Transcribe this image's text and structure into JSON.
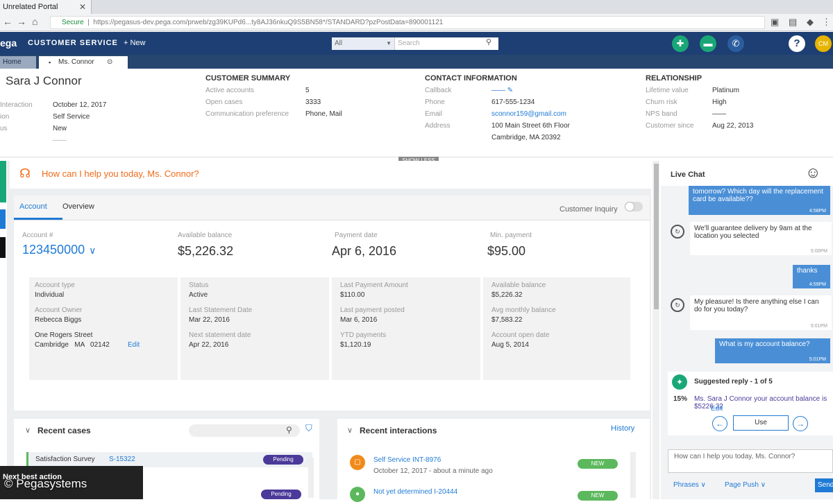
{
  "browser": {
    "tab_title": "Unrelated Portal",
    "url_prefix": "Secure",
    "url": "https://pegasus-dev.pega.com/prweb/zg39KUPd6...ty8AJ36nkuQ9S5BN58*/STANDARD?pzPostData=890001121"
  },
  "header": {
    "logo": "ega",
    "app_name": "CUSTOMER SERVICE",
    "new_label": "+ New",
    "search_scope": "All",
    "search_placeholder": "Search",
    "avatar": "CM"
  },
  "tabs": {
    "home": "Home",
    "case": "Ms. Connor"
  },
  "customer": {
    "name": "Sara J Connor",
    "fields": [
      {
        "label": "Interaction",
        "value": "October 12, 2017"
      },
      {
        "label": "ion",
        "value": "Self Service"
      },
      {
        "label": "us",
        "value": "New"
      },
      {
        "label": "",
        "value": "——"
      }
    ]
  },
  "summary": {
    "title": "CUSTOMER SUMMARY",
    "rows": [
      {
        "label": "Active accounts",
        "value": "5"
      },
      {
        "label": "Open cases",
        "value": "3333"
      },
      {
        "label": "Communication preference",
        "value": "Phone, Mail"
      }
    ]
  },
  "contact": {
    "title": "CONTACT INFORMATION",
    "rows": [
      {
        "label": "Callback",
        "value": "——"
      },
      {
        "label": "Phone",
        "value": "617-555-1234"
      },
      {
        "label": "Email",
        "value": "sconnor159@gmail.com"
      },
      {
        "label": "Address",
        "value": "100 Main Street 6th Floor"
      },
      {
        "label": "",
        "value": "Cambridge, MA 20392"
      }
    ]
  },
  "relationship": {
    "title": "RELATIONSHIP",
    "rows": [
      {
        "label": "Lifetime value",
        "value": "Platinum"
      },
      {
        "label": "Churn risk",
        "value": "High"
      },
      {
        "label": "NPS band",
        "value": "——"
      },
      {
        "label": "Customer since",
        "value": "Aug 22, 2013"
      }
    ]
  },
  "show_less": "SHOW LESS",
  "greeting": "How can I help you today, Ms. Connor?",
  "account_tabs": {
    "account": "Account",
    "overview": "Overview",
    "inquiry": "Customer Inquiry"
  },
  "kpis": [
    {
      "label": "Account #",
      "value": "123450000"
    },
    {
      "label": "Available balance",
      "value": "$5,226.32"
    },
    {
      "label": "Payment date",
      "value": "Apr 6, 2016"
    },
    {
      "label": "Min. payment",
      "value": "$95.00"
    }
  ],
  "details": [
    [
      {
        "label": "Account type",
        "value": "Individual"
      },
      {
        "label": "Account Owner",
        "value": "Rebecca Biggs"
      },
      {
        "label": "",
        "value": "One Rogers Street"
      },
      {
        "label": "",
        "value": "Cambridge   MA   02142"
      }
    ],
    [
      {
        "label": "Status",
        "value": "Active"
      },
      {
        "label": "Last Statement Date",
        "value": "Mar 22, 2016"
      },
      {
        "label": "Next statement date",
        "value": "Apr 22, 2016"
      }
    ],
    [
      {
        "label": "Last Payment Amount",
        "value": "$110.00"
      },
      {
        "label": "Last payment posted",
        "value": "Mar 6, 2016"
      },
      {
        "label": "YTD payments",
        "value": "$1,120.19"
      }
    ],
    [
      {
        "label": "Available balance",
        "value": "$5,226.32"
      },
      {
        "label": "Avg monthly balance",
        "value": "$7,583.22"
      },
      {
        "label": "Account open date",
        "value": "Aug 5, 2014"
      }
    ]
  ],
  "edit_label": "Edit",
  "recent_cases": {
    "title": "Recent cases",
    "rows": [
      {
        "name": "Satisfaction Survey",
        "id": "S-15322",
        "status": "Pending"
      },
      {
        "name": "",
        "id": "",
        "status": "Pending"
      }
    ]
  },
  "recent_interactions": {
    "title": "Recent interactions",
    "history": "History",
    "rows": [
      {
        "title": "Self Service",
        "id": "INT-8976",
        "sub": "October 12, 2017 - about a minute ago",
        "status": "NEW"
      },
      {
        "title": "Not yet determined",
        "id": "I-20444",
        "sub": "",
        "status": "NEW"
      }
    ]
  },
  "next_best_action": "Next best action",
  "watermark": "© Pegasystems",
  "chat": {
    "title": "Live Chat",
    "messages": [
      {
        "from": "user",
        "text": "tomorrow? Which day will the replacement card be available??",
        "time": "4:58PM"
      },
      {
        "from": "agent",
        "text": "We'll guarantee delivery by 9am at the location you selected",
        "time": "5:00PM"
      },
      {
        "from": "user",
        "text": "thanks",
        "time": "4:59PM"
      },
      {
        "from": "agent",
        "text": "My pleasure! Is there anything else I can do for you today?",
        "time": "5:01PM"
      },
      {
        "from": "user",
        "text": "What is my account balance?",
        "time": "5:01PM"
      }
    ],
    "suggested_title": "Suggested reply - 1 of 5",
    "suggested_pct": "15%",
    "suggested_text": "Ms. Sara J Connor your account balance is $5226.32",
    "suggested_edit": "Edit",
    "use_label": "Use",
    "input_text": "How can I help you today, Ms. Connor?",
    "phrases": "Phrases",
    "page_push": "Page Push",
    "send": "Send"
  },
  "colors": {
    "header_bg": "#1d3f73",
    "accent_blue": "#1f7ad6",
    "greeting_orange": "#f06b1a",
    "green": "#1aa777",
    "badge_purple": "#4b3a99",
    "new_green": "#5cb85c"
  }
}
